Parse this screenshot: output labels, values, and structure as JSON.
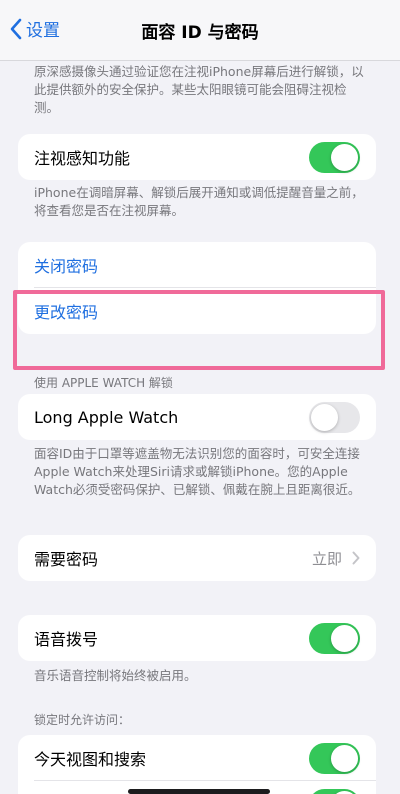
{
  "nav": {
    "back_label": "设置",
    "title": "面容 ID 与密码"
  },
  "attention_note": "原深感摄像头通过验证您在注视iPhone屏幕后进行解锁，以此提供额外的安全保护。某些太阳眼镜可能会阻碍注视检测。",
  "attention_feature": {
    "label": "注视感知功能",
    "enabled": true
  },
  "attention_feature_note": "iPhone在调暗屏幕、解锁后展开通知或调低提醒音量之前，将查看您是否在注视屏幕。",
  "passcode": {
    "turn_off_label": "关闭密码",
    "change_label": "更改密码"
  },
  "apple_watch": {
    "section_header": "使用 APPLE WATCH 解锁",
    "device_label": "Long Apple Watch",
    "enabled": false,
    "note": "面容ID由于口罩等遮盖物无法识别您的面容时，可安全连接Apple Watch来处理Siri请求或解锁iPhone。您的Apple Watch必须受密码保护、已解锁、佩戴在腕上且距离很近。"
  },
  "require_passcode": {
    "label": "需要密码",
    "value": "立即"
  },
  "voice_dial": {
    "label": "语音拨号",
    "enabled": true,
    "note": "音乐语音控制将始终被启用。"
  },
  "locked_access": {
    "section_header": "锁定时允许访问：",
    "today_view": {
      "label": "今天视图和搜索",
      "enabled": true
    }
  },
  "colors": {
    "accent": "#1f6fe0",
    "toggle_on": "#34c759",
    "highlight": "#f06a99"
  }
}
